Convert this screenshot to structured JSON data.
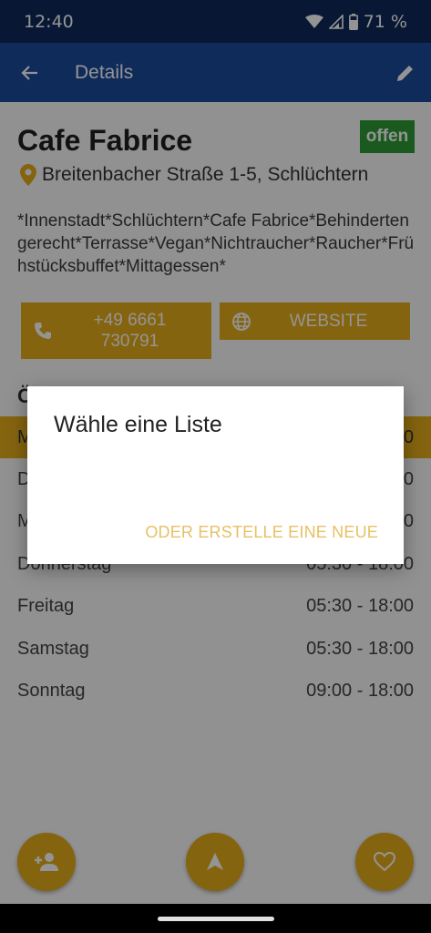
{
  "status_bar": {
    "time": "12:40",
    "battery": "71 %"
  },
  "app_bar": {
    "title": "Details"
  },
  "place": {
    "name": "Cafe Fabrice",
    "status_badge": "offen",
    "address": "Breitenbacher Straße 1-5, Schlüchtern",
    "tags": "*Innenstadt*Schlüchtern*Cafe Fabrice*Behindertengerecht*Terrasse*Vegan*Nichtraucher*Raucher*Frühstücksbuffet*Mittagessen*"
  },
  "actions": {
    "phone_line1": "+49 6661",
    "phone_line2": "730791",
    "website": "WEBSITE"
  },
  "hours": {
    "heading": "Ö",
    "rows": [
      {
        "day": "M",
        "time": "00"
      },
      {
        "day": "D",
        "time": "00"
      },
      {
        "day": "M",
        "time": "00"
      },
      {
        "day": "Donnerstag",
        "time": "05:30 - 18:00"
      },
      {
        "day": "Freitag",
        "time": "05:30 - 18:00"
      },
      {
        "day": "Samstag",
        "time": "05:30 - 18:00"
      },
      {
        "day": "Sonntag",
        "time": "09:00 - 18:00"
      }
    ]
  },
  "dialog": {
    "title": "Wähle eine Liste",
    "action": "ODER ERSTELLE EINE NEUE"
  },
  "colors": {
    "primary": "#1a4a9c",
    "accent": "#e6ac1a",
    "open_green": "#2e9c36"
  }
}
